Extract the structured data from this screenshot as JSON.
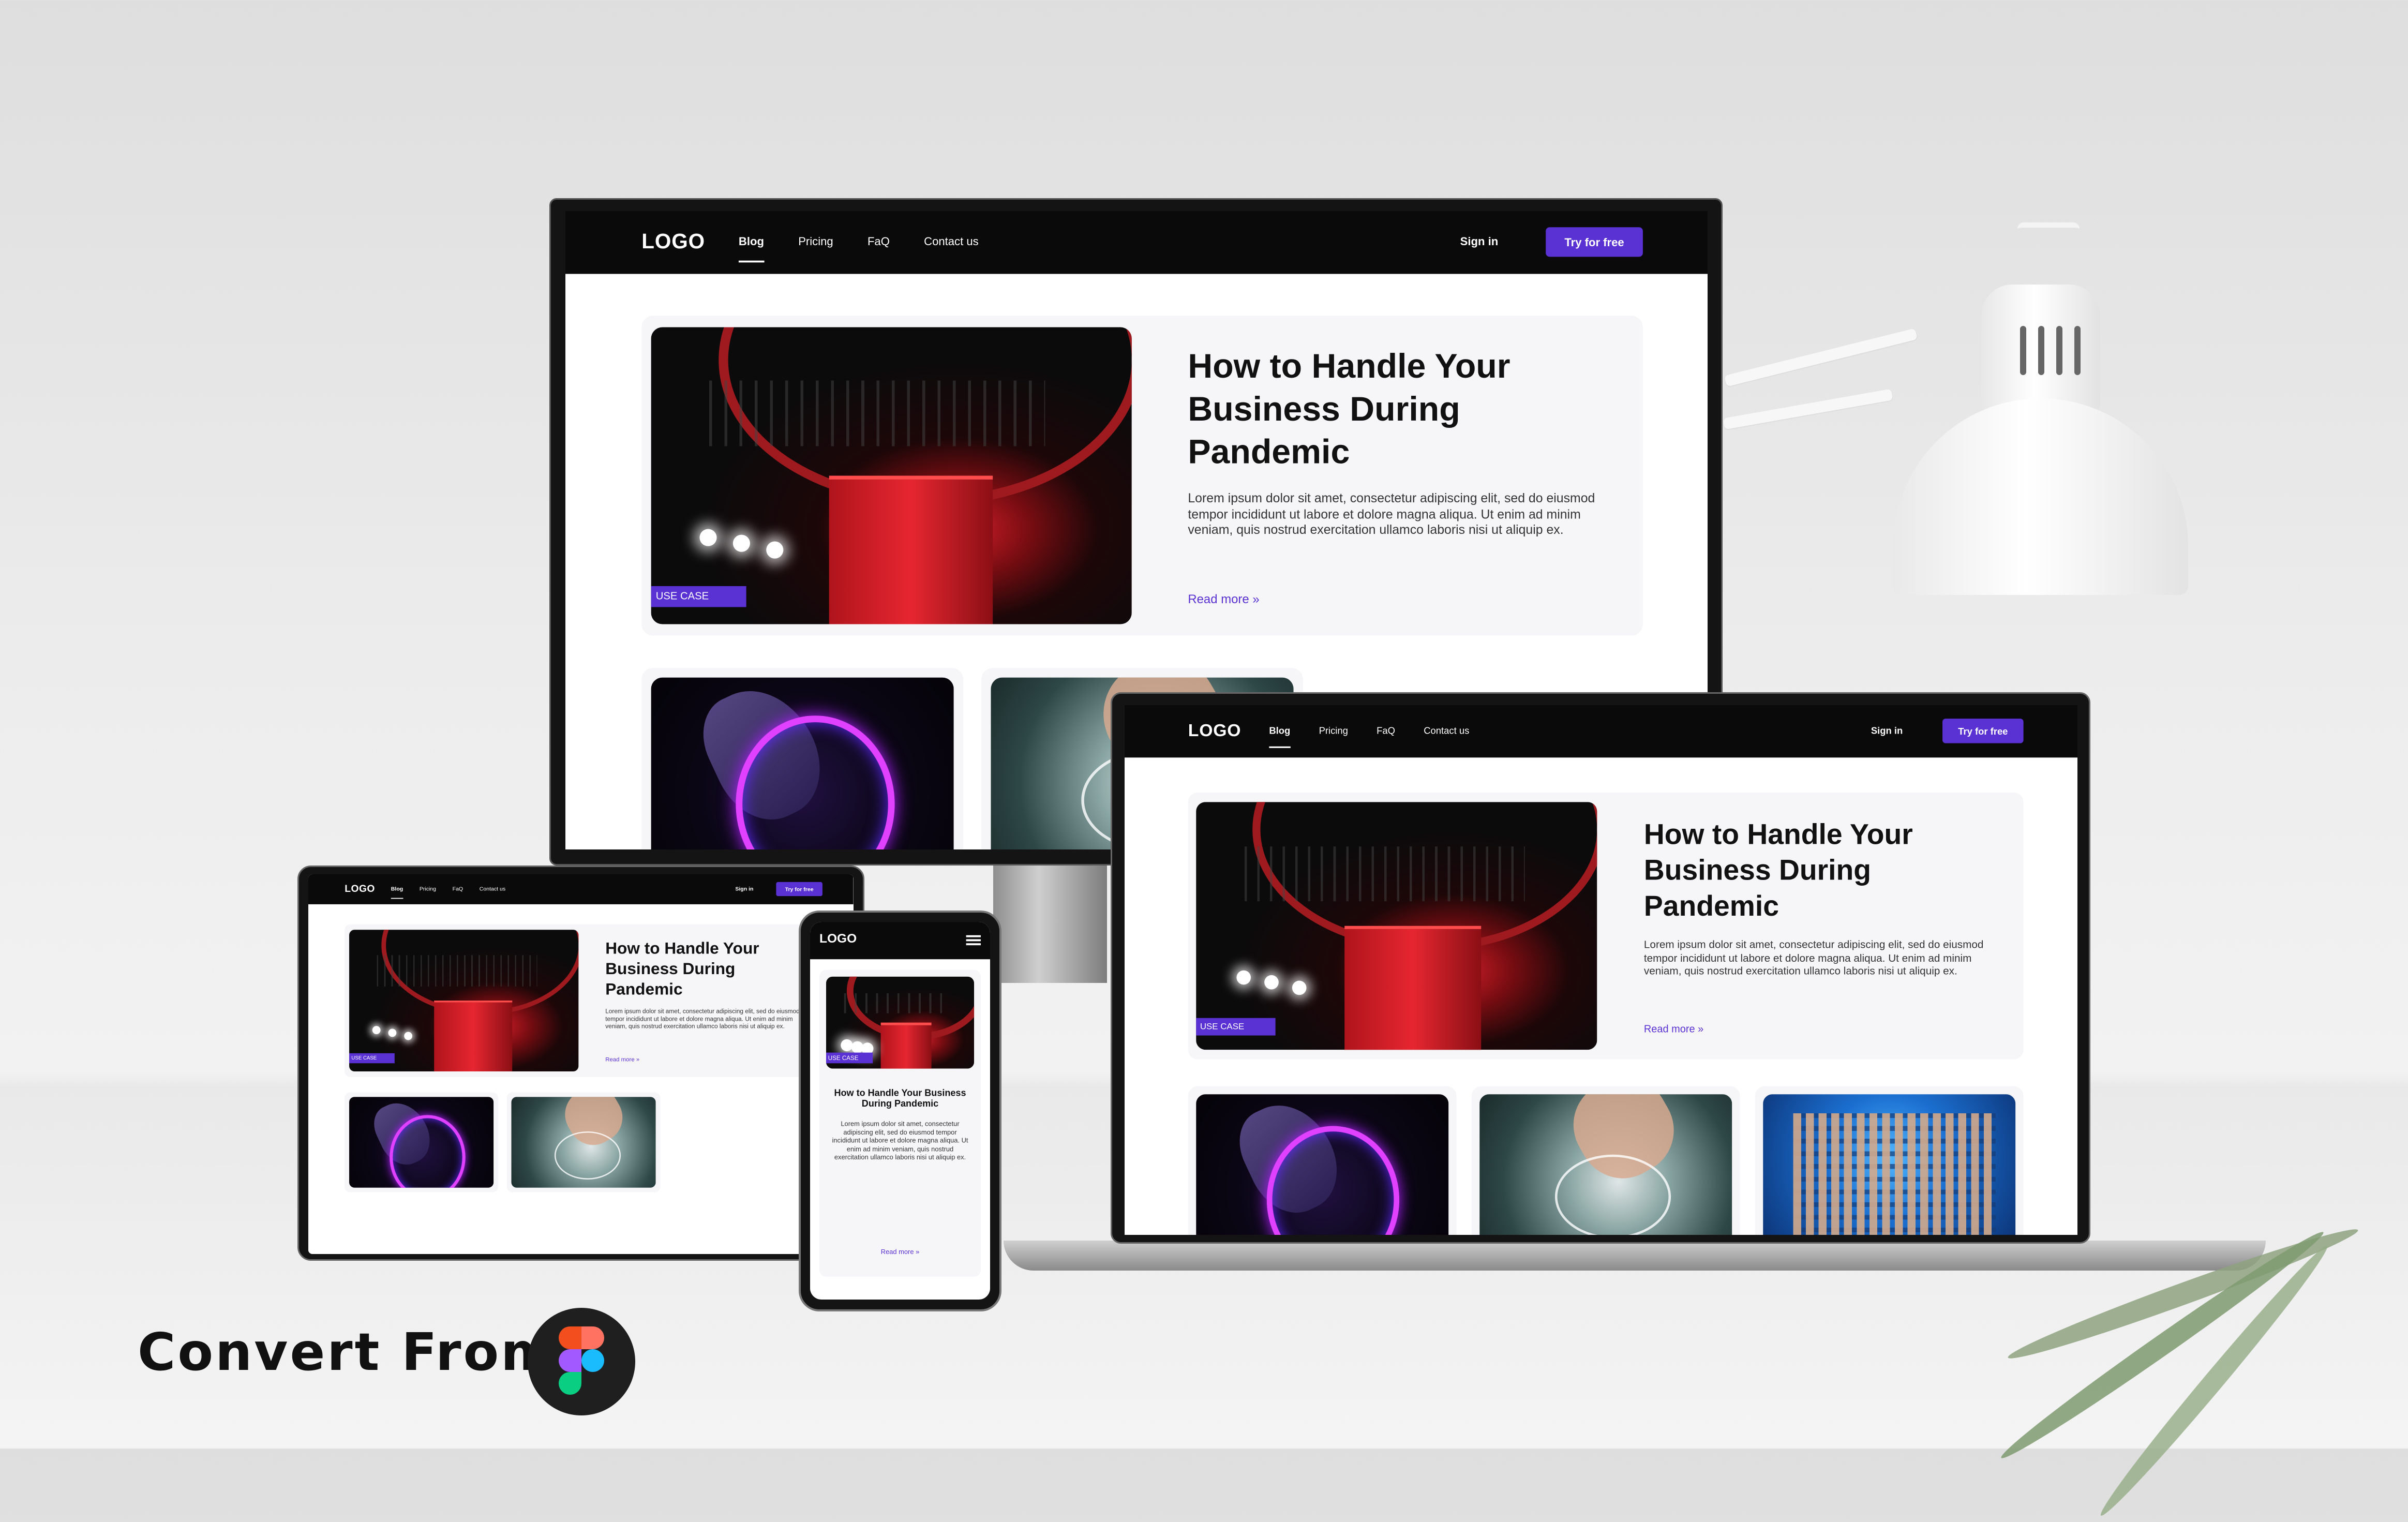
{
  "site": {
    "logo": "LOGO",
    "nav": [
      "Blog",
      "Pricing",
      "FaQ",
      "Contact us"
    ],
    "signin": "Sign in",
    "cta": "Try for free"
  },
  "post": {
    "tag": "USE CASE",
    "title": "How to Handle Your Business During Pandemic",
    "body": "Lorem ipsum dolor sit amet, consectetur adipiscing elit, sed do eiusmod tempor incididunt ut labore et dolore magna aliqua. Ut enim ad minim veniam, quis nostrud exercitation ullamco laboris nisi ut aliquip ex.",
    "read_more": "Read more »"
  },
  "banner": {
    "text": "Convert From"
  },
  "colors": {
    "accent": "#5a31d3",
    "nav_bg": "#0a0a0a",
    "card_bg": "#f6f6f8"
  }
}
